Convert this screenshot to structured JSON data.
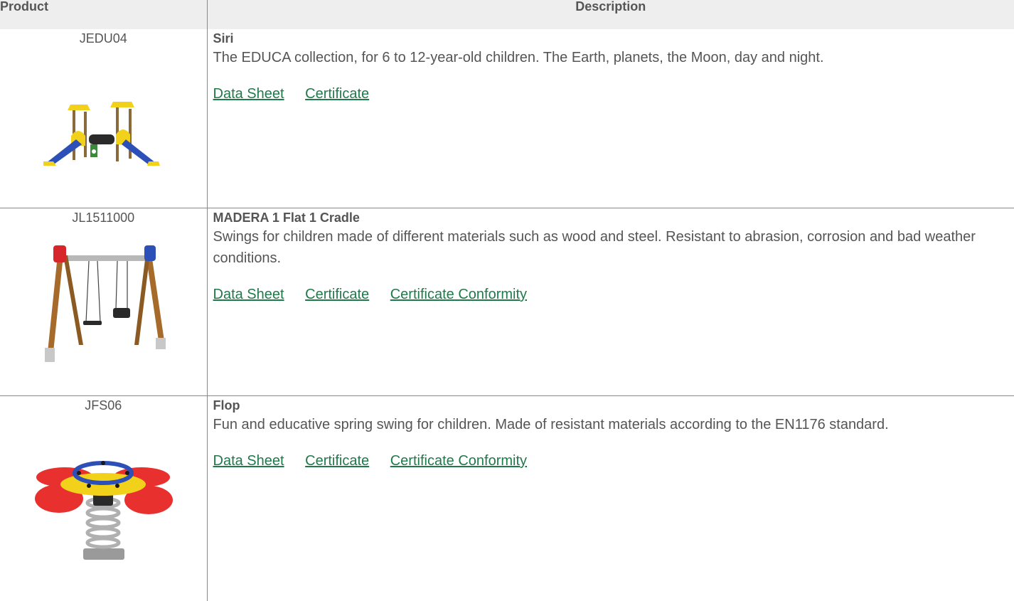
{
  "table": {
    "headers": {
      "product": "Product",
      "description": "Description"
    }
  },
  "products": [
    {
      "code": "JEDU04",
      "name": "Siri",
      "description": "The EDUCA collection, for 6 to 12-year-old children. The Earth, planets, the Moon, day and night.",
      "links": [
        "Data Sheet",
        "Certificate"
      ]
    },
    {
      "code": "JL1511000",
      "name": "MADERA 1 Flat 1 Cradle",
      "description": "Swings for children made of different materials such as wood and steel. Resistant to abrasion, corrosion and bad weather conditions.",
      "links": [
        "Data Sheet",
        "Certificate",
        "Certificate Conformity"
      ]
    },
    {
      "code": "JFS06",
      "name": "Flop",
      "description": "Fun and educative spring swing for children. Made of resistant materials according to the EN1176 standard.",
      "links": [
        "Data Sheet",
        "Certificate",
        "Certificate Conformity"
      ]
    }
  ],
  "colors": {
    "link": "#1f7a4a",
    "text": "#555555",
    "header_bg": "#eeeeee",
    "divider": "#888888"
  }
}
